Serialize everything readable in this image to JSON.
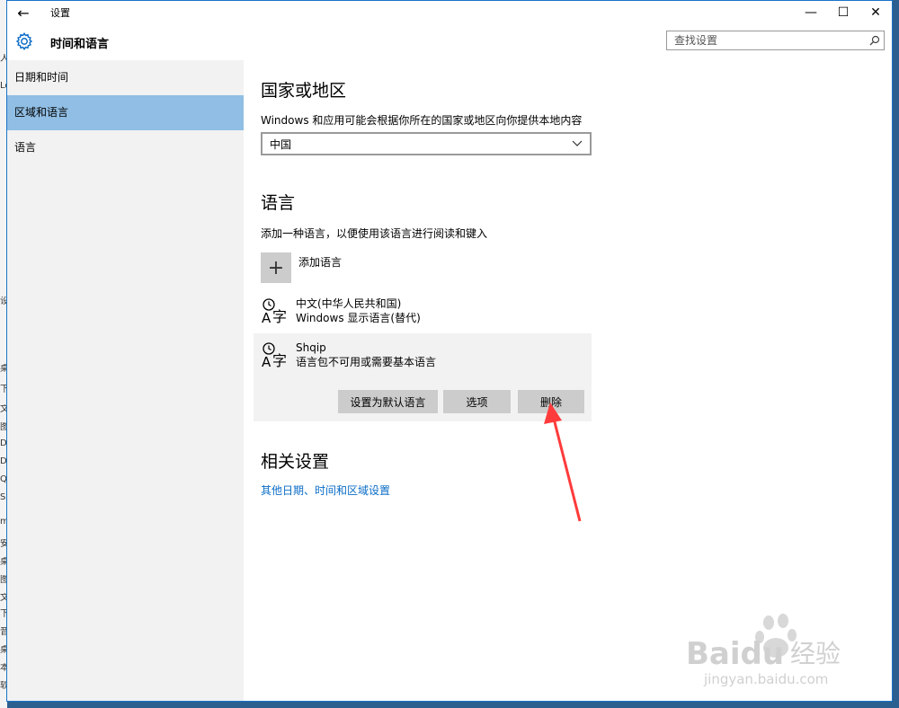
{
  "window": {
    "title": "设置",
    "controls": {
      "minimize": "—",
      "maximize": "☐",
      "close": "✕"
    },
    "back": "←"
  },
  "header": {
    "title": "时间和语言",
    "search_placeholder": "查找设置"
  },
  "sidebar": {
    "items": [
      {
        "label": "日期和时间",
        "active": false
      },
      {
        "label": "区域和语言",
        "active": true
      },
      {
        "label": "语言",
        "active": false
      }
    ]
  },
  "region": {
    "heading": "国家或地区",
    "description": "Windows 和应用可能会根据你所在的国家或地区向你提供本地内容",
    "selected": "中国"
  },
  "language": {
    "heading": "语言",
    "description": "添加一种语言，以便使用该语言进行阅读和键入",
    "add_label": "添加语言",
    "items": [
      {
        "name": "中文(中华人民共和国)",
        "detail": "Windows 显示语言(替代)"
      },
      {
        "name": "Shqip",
        "detail": "语言包不可用或需要基本语言"
      }
    ],
    "buttons": {
      "set_default": "设置为默认语言",
      "options": "选项",
      "remove": "删除"
    }
  },
  "related": {
    "heading": "相关设置",
    "link": "其他日期、时间和区域设置"
  },
  "desktop_chars": [
    "人",
    "Lo",
    "设",
    "桌",
    "下",
    "文",
    "图",
    "D",
    "D",
    "Q",
    "S",
    "m",
    "安",
    "桌",
    "图",
    "文",
    "下",
    "音",
    "桌",
    "本",
    "软"
  ],
  "watermark": {
    "brand": "Baidu",
    "suffix": "经验",
    "url": "jingyan.baidu.com"
  },
  "colors": {
    "accent": "#0a6cc7",
    "selected_nav": "#90bee4",
    "annotation": "#ff3b3b"
  }
}
